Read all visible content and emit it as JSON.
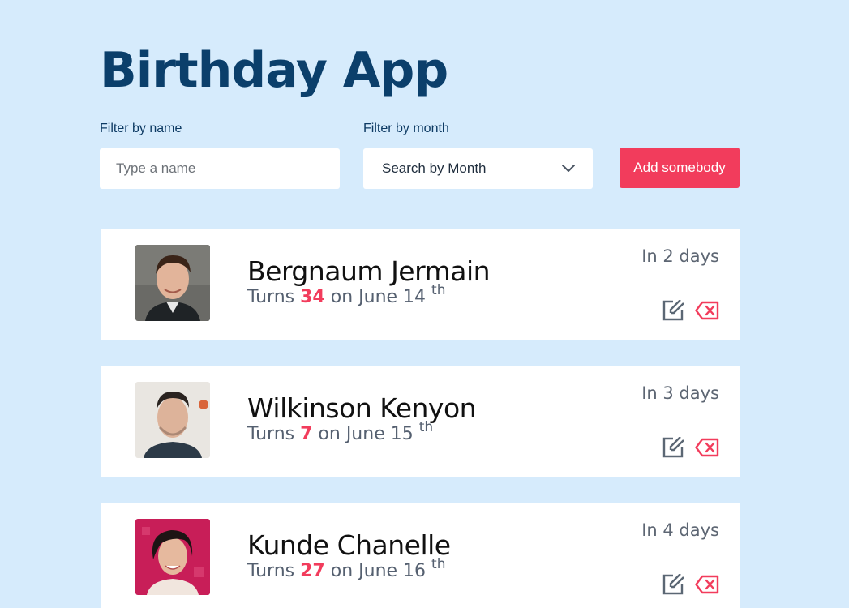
{
  "header": {
    "title": "Birthday App"
  },
  "filters": {
    "name_label": "Filter by name",
    "name_placeholder": "Type a name",
    "month_label": "Filter by month",
    "month_value": "Search by Month"
  },
  "actions": {
    "add_label": "Add somebody"
  },
  "colors": {
    "accent": "#f23c5c",
    "background": "#d6ebfc",
    "title": "#0b3f6b"
  },
  "people": [
    {
      "name": "Bergnaum Jermain",
      "turns_prefix": "Turns",
      "age": "34",
      "on_text": "on June 14",
      "suffix": "th",
      "days": "In 2 days"
    },
    {
      "name": "Wilkinson Kenyon",
      "turns_prefix": "Turns",
      "age": "7",
      "on_text": "on June 15",
      "suffix": "th",
      "days": "In 3 days"
    },
    {
      "name": "Kunde Chanelle",
      "turns_prefix": "Turns",
      "age": "27",
      "on_text": "on June 16",
      "suffix": "th",
      "days": "In 4 days"
    }
  ]
}
